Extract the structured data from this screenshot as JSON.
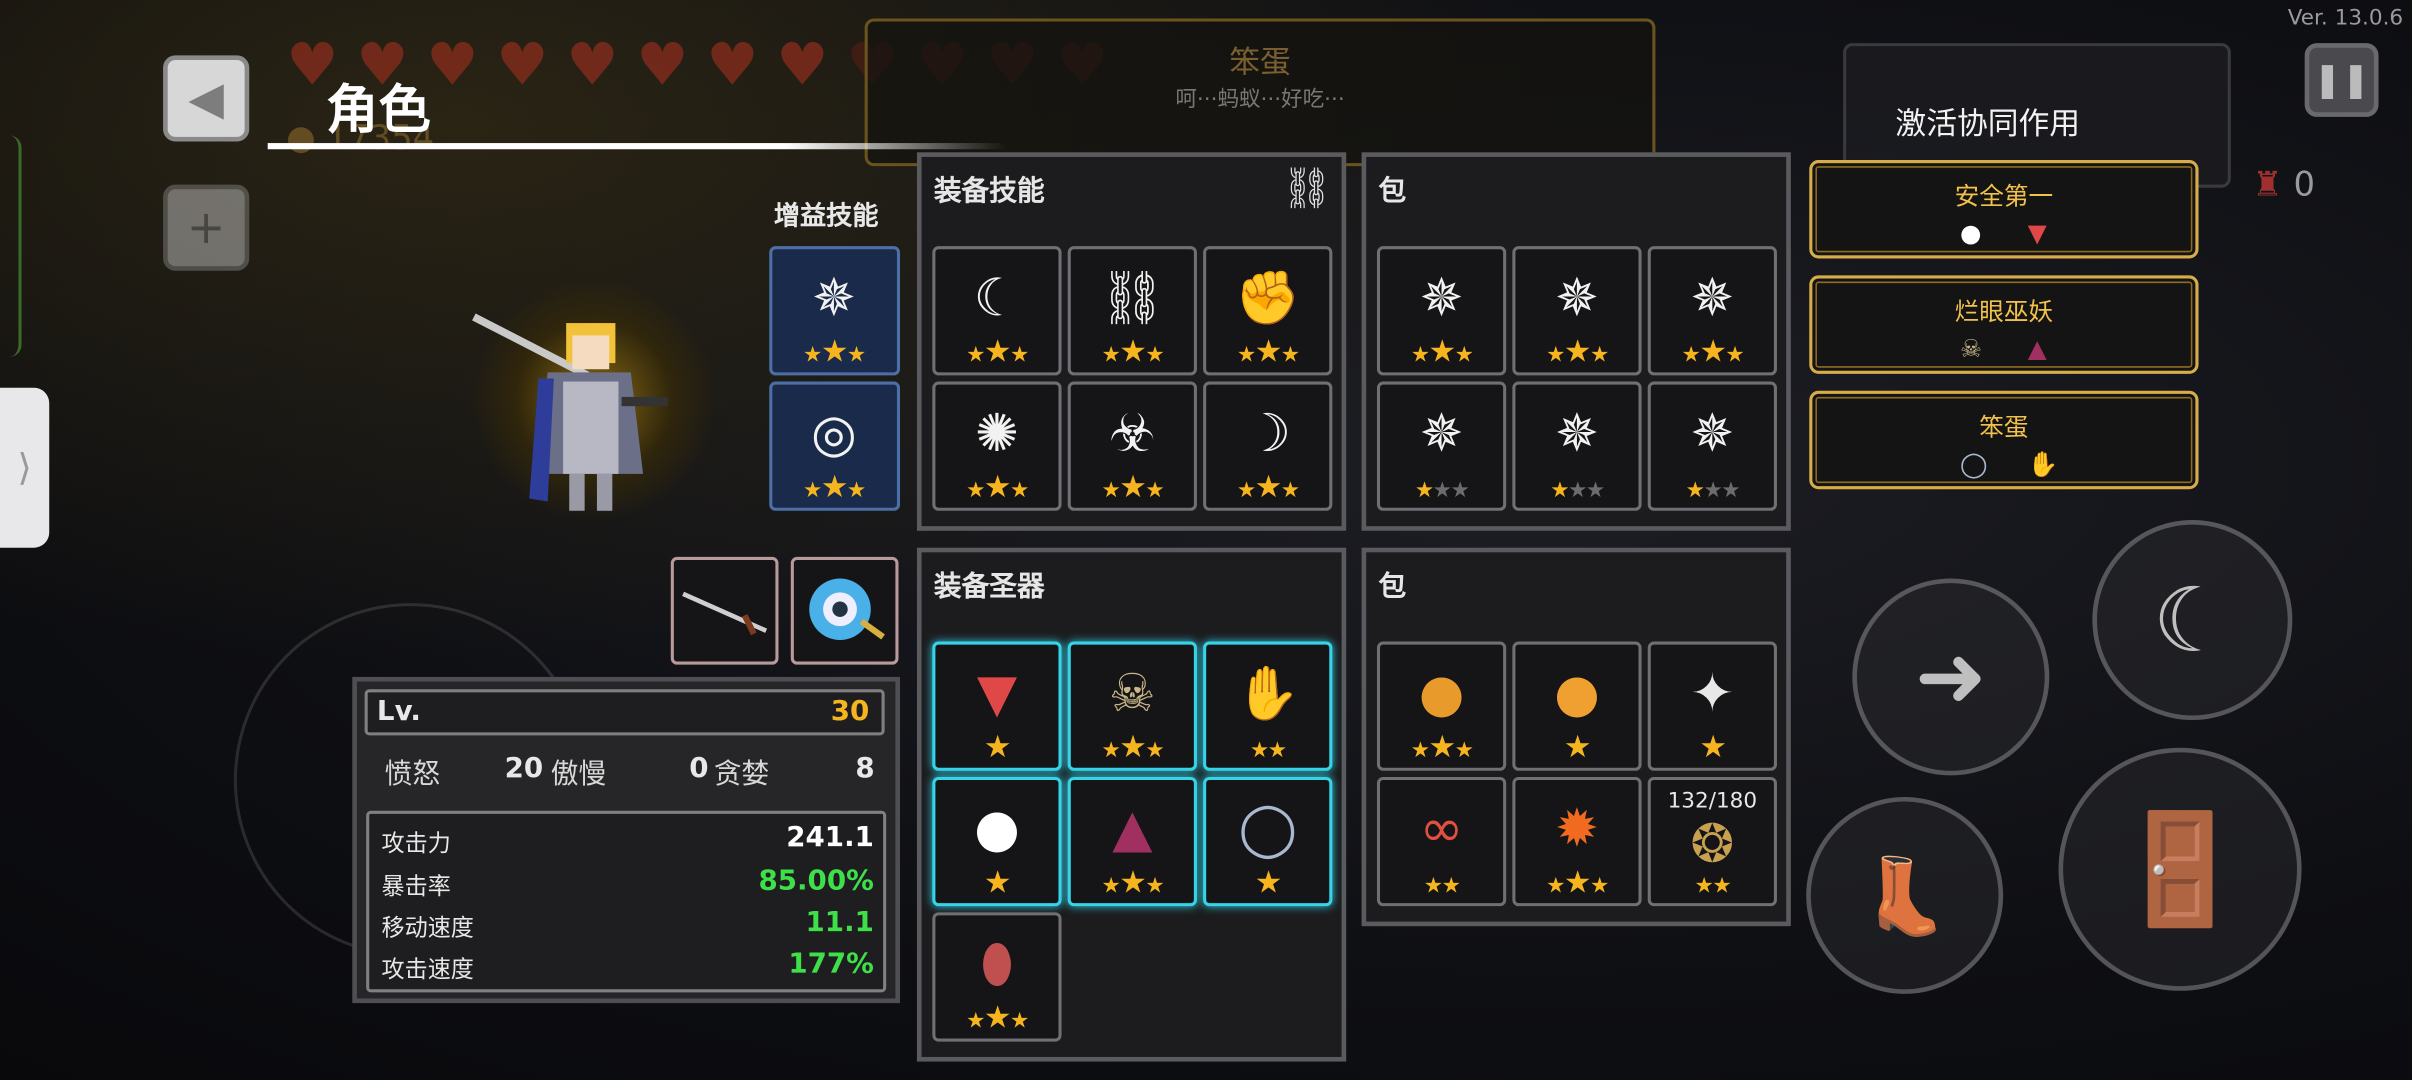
{
  "version": "Ver. 13.0.6",
  "header": {
    "title": "角色",
    "gold": "17354",
    "hearts_full": 8,
    "hearts_total": 12
  },
  "banner": {
    "name": "笨蛋",
    "subtitle": "呵···蚂蚁···好吃···"
  },
  "buff": {
    "label": "增益技能",
    "slots": [
      {
        "icon": "lich-skill-icon",
        "stars": 3,
        "filled": 3
      },
      {
        "icon": "vortex-skill-icon",
        "stars": 3,
        "filled": 3
      }
    ]
  },
  "weapons": [
    {
      "icon": "sword-icon"
    },
    {
      "icon": "shield-ring-icon"
    }
  ],
  "stats": {
    "level_label": "Lv.",
    "level": "30",
    "sins": [
      {
        "label": "愤怒",
        "value": "20"
      },
      {
        "label": "傲慢",
        "value": "0"
      },
      {
        "label": "贪婪",
        "value": "8"
      }
    ],
    "rows": [
      {
        "label": "攻击力",
        "value": "241.1",
        "color": "#ffffff"
      },
      {
        "label": "暴击率",
        "value": "85.00%",
        "color": "#3ee04a"
      },
      {
        "label": "移动速度",
        "value": "11.1",
        "color": "#3ee04a"
      },
      {
        "label": "攻击速度",
        "value": "177%",
        "color": "#3ee04a"
      }
    ]
  },
  "equip_skills": {
    "title": "装备技能",
    "slots": [
      {
        "icon": "scythe-icon",
        "stars": 3,
        "filled": 3
      },
      {
        "icon": "bone-chain-icon",
        "stars": 3,
        "filled": 3
      },
      {
        "icon": "fist-icon",
        "stars": 3,
        "filled": 3
      },
      {
        "icon": "burst-icon",
        "stars": 3,
        "filled": 3
      },
      {
        "icon": "biohazard-icon",
        "stars": 3,
        "filled": 3
      },
      {
        "icon": "crescent-icon",
        "stars": 3,
        "filled": 3
      }
    ]
  },
  "skill_bag": {
    "title": "包",
    "slots": [
      {
        "icon": "lich-skill-icon",
        "stars": 3,
        "filled": 3
      },
      {
        "icon": "lich-skill-icon",
        "stars": 3,
        "filled": 3
      },
      {
        "icon": "lich-skill-icon",
        "stars": 3,
        "filled": 3
      },
      {
        "icon": "lich-skill-icon",
        "stars": 3,
        "filled": 1
      },
      {
        "icon": "lich-skill-icon",
        "stars": 3,
        "filled": 1
      },
      {
        "icon": "lich-skill-icon",
        "stars": 3,
        "filled": 1
      }
    ]
  },
  "equip_relics": {
    "title": "装备圣器",
    "slots": [
      {
        "icon": "fox-mask-icon",
        "stars": 1,
        "filled": 1
      },
      {
        "icon": "skull-icon",
        "stars": 3,
        "filled": 3
      },
      {
        "icon": "gauntlet-icon",
        "stars": 2,
        "filled": 2
      },
      {
        "icon": "white-skull-icon",
        "stars": 1,
        "filled": 1
      },
      {
        "icon": "cloak-icon",
        "stars": 3,
        "filled": 3
      },
      {
        "icon": "ring-icon",
        "stars": 1,
        "filled": 1
      },
      {
        "icon": "egg-icon",
        "stars": 3,
        "filled": 3
      }
    ]
  },
  "relic_bag": {
    "title": "包",
    "slots": [
      {
        "icon": "orange-orb-icon",
        "stars": 3,
        "filled": 3,
        "count": ""
      },
      {
        "icon": "cookie-icon",
        "stars": 1,
        "filled": 1,
        "count": ""
      },
      {
        "icon": "wand-icon",
        "stars": 1,
        "filled": 1,
        "count": ""
      },
      {
        "icon": "glasses-icon",
        "stars": 2,
        "filled": 2,
        "count": ""
      },
      {
        "icon": "fire-orb-icon",
        "stars": 3,
        "filled": 3,
        "count": ""
      },
      {
        "icon": "eggs-nest-icon",
        "stars": 2,
        "filled": 2,
        "count": "132/180"
      }
    ]
  },
  "synergy": {
    "title": "激活协同作用",
    "items": [
      {
        "name": "安全第一",
        "icons": [
          "white-skull-icon",
          "fox-mask-icon"
        ]
      },
      {
        "name": "烂眼巫妖",
        "icons": [
          "skull-icon",
          "cloak-icon"
        ]
      },
      {
        "name": "笨蛋",
        "icons": [
          "ring-icon",
          "gauntlet-icon"
        ]
      }
    ]
  },
  "enemy_count": "0",
  "colors": {
    "accent": "#f6b51f",
    "cyan": "#35d4e8",
    "green": "#3ee04a",
    "gold_border": "#d6ad4a"
  }
}
